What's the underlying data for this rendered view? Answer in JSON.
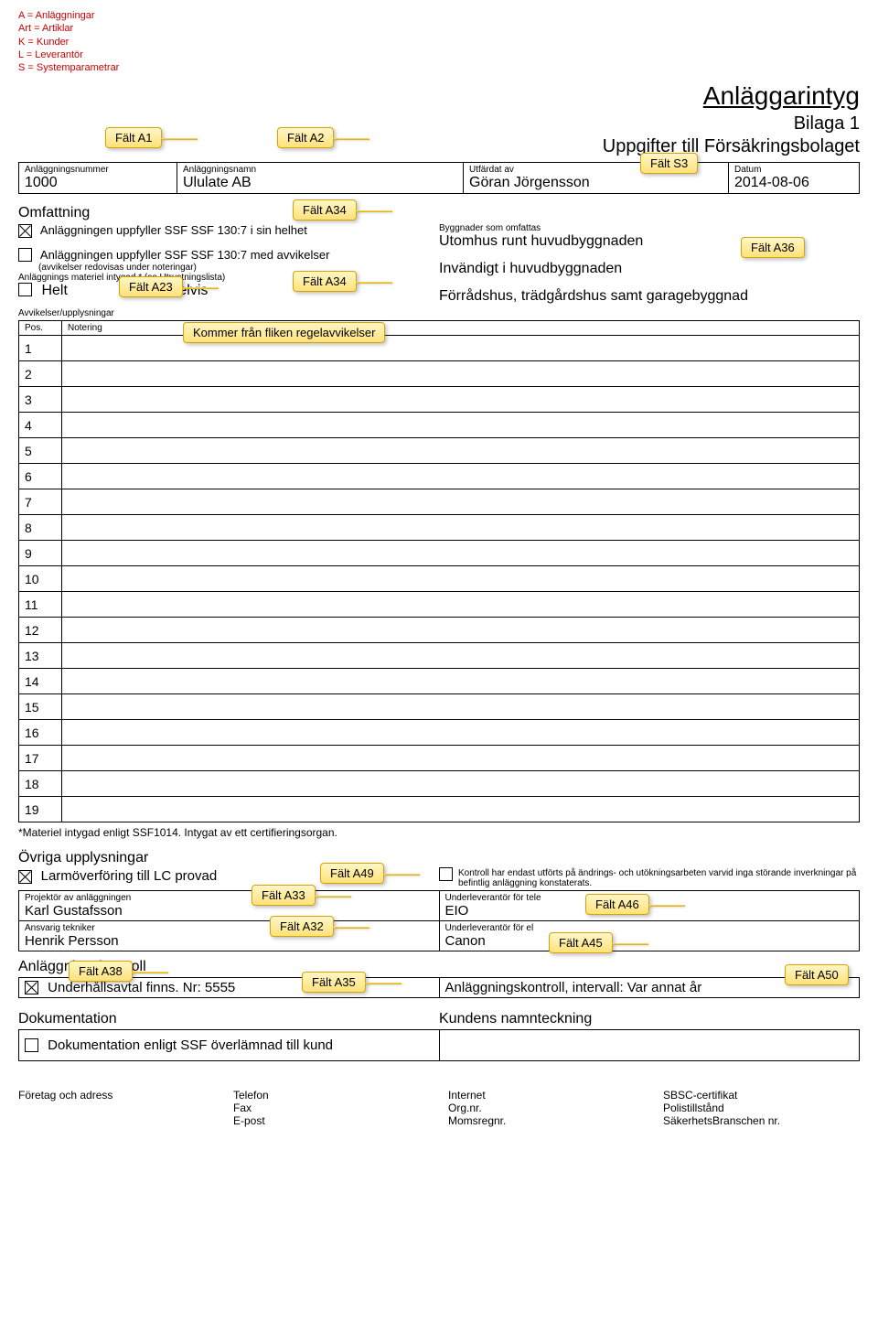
{
  "legend": [
    "A = Anläggningar",
    "Art = Artiklar",
    "K = Kunder",
    "L = Leverantör",
    "S = Systemparametrar"
  ],
  "title": "Anläggarintyg",
  "subtitle_line1": "Bilaga 1",
  "subtitle_line2": "Uppgifter till Försäkringsbolaget",
  "header": {
    "num_label": "Anläggningsnummer",
    "num": "1000",
    "name_label": "Anläggningsnamn",
    "name": "Ululate AB",
    "issuer_label": "Utfärdat av",
    "issuer": "Göran Jörgensson",
    "date_label": "Datum",
    "date": "2014-08-06"
  },
  "tags": {
    "a1": "Fält A1",
    "a2": "Fält A2",
    "s3": "Fält S3",
    "a34": "Fält A34",
    "a34b": "Fält A34",
    "a23": "Fält A23",
    "a36": "Fält A36",
    "regel": "Kommer från fliken regelavvikelser",
    "a49": "Fält A49",
    "a33": "Fält A33",
    "a32": "Fält A32",
    "a46": "Fält A46",
    "a45": "Fält A45",
    "a38": "Fält A38",
    "a35": "Fält A35",
    "a50": "Fält A50"
  },
  "omfattning": {
    "title": "Omfattning",
    "c1": "Anläggningen uppfyller SSF SSF 130:7 i sin helhet",
    "c2": "Anläggningen uppfyller SSF SSF 130:7 med avvikelser",
    "c2_sub": "(avvikelser redovisas under noteringar)",
    "c3": "Anläggnings materiel intygad * (se Utrustningslista)",
    "helt": "Helt",
    "delvis": "Delvis",
    "byggnader_label": "Byggnader som omfattas",
    "b1": "Utomhus runt huvudbyggnaden",
    "b2": "Invändigt i huvudbyggnaden",
    "b3": "Förrådshus, trädgårdshus samt garagebyggnad"
  },
  "avvikelser": {
    "title": "Avvikelser/upplysningar",
    "pos": "Pos.",
    "not": "Notering",
    "rows": [
      "1",
      "2",
      "3",
      "4",
      "5",
      "6",
      "7",
      "8",
      "9",
      "10",
      "11",
      "12",
      "13",
      "14",
      "15",
      "16",
      "17",
      "18",
      "19"
    ],
    "footnote": "*Materiel intygad enligt SSF1014. Intygat av ett certifieringsorgan."
  },
  "ovrigt": {
    "title": "Övriga upplysningar",
    "larm": "Larmöverföring till LC provad",
    "kontroll": "Kontroll har endast utförts på ändrings- och utökningsarbeten varvid inga störande inverkningar på befintlig anläggning konstaterats.",
    "proj_label": "Projektör av anläggningen",
    "proj": "Karl Gustafsson",
    "tek_label": "Ansvarig tekniker",
    "tek": "Henrik Persson",
    "tele_label": "Underleverantör för tele",
    "tele": "EIO",
    "el_label": "Underleverantör för el",
    "el": "Canon"
  },
  "kontroll": {
    "title": "Anläggningskontroll",
    "avtal": "Underhållsavtal finns. Nr: 5555",
    "interval": "Anläggningskontroll, intervall: Var annat år"
  },
  "dok": {
    "title": "Dokumentation",
    "sign": "Kundens namnteckning",
    "text": "Dokumentation enligt SSF överlämnad till kund"
  },
  "footer": {
    "company": "Företag och adress",
    "tel": "Telefon",
    "fax": "Fax",
    "epost": "E-post",
    "internet": "Internet",
    "org": "Org.nr.",
    "moms": "Momsregnr.",
    "sbsc": "SBSC-certifikat",
    "polis": "Polistillstånd",
    "sak": "SäkerhetsBranschen nr."
  }
}
